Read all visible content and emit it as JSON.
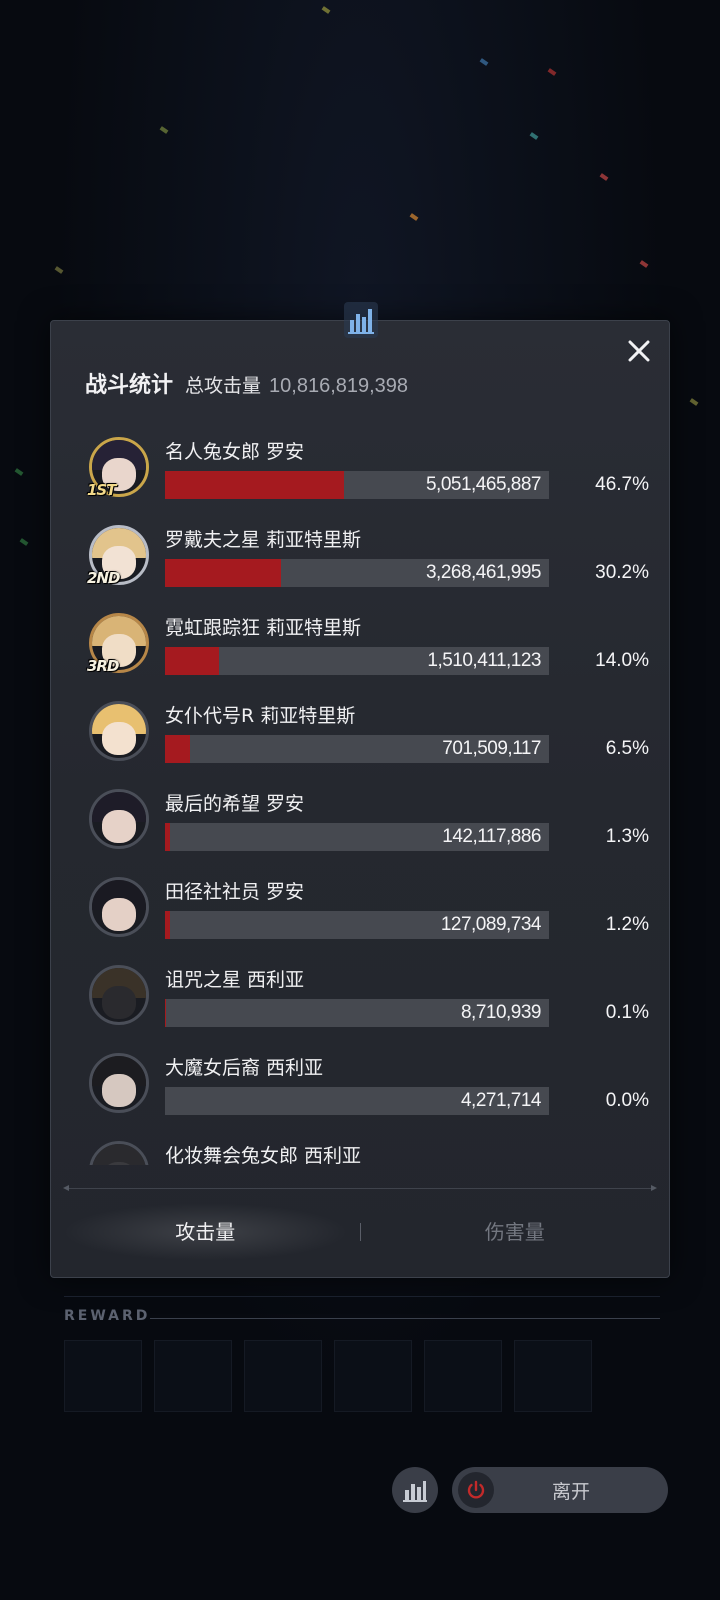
{
  "panel": {
    "title": "战斗统计",
    "total_label": "总攻击量",
    "total_value": "10,816,819,398"
  },
  "entries": [
    {
      "name": "名人兔女郎 罗安",
      "amount": "5,051,465,887",
      "percent": "46.7%",
      "share": 0.467,
      "rank": "1ST"
    },
    {
      "name": "罗戴夫之星 莉亚特里斯",
      "amount": "3,268,461,995",
      "percent": "30.2%",
      "share": 0.302,
      "rank": "2ND"
    },
    {
      "name": "霓虹跟踪狂 莉亚特里斯",
      "amount": "1,510,411,123",
      "percent": "14.0%",
      "share": 0.14,
      "rank": "3RD"
    },
    {
      "name": "女仆代号R 莉亚特里斯",
      "amount": "701,509,117",
      "percent": "6.5%",
      "share": 0.065
    },
    {
      "name": "最后的希望 罗安",
      "amount": "142,117,886",
      "percent": "1.3%",
      "share": 0.013
    },
    {
      "name": "田径社社员 罗安",
      "amount": "127,089,734",
      "percent": "1.2%",
      "share": 0.012
    },
    {
      "name": "诅咒之星 西利亚",
      "amount": "8,710,939",
      "percent": "0.1%",
      "share": 0.001
    },
    {
      "name": "大魔女后裔 西利亚",
      "amount": "4,271,714",
      "percent": "0.0%",
      "share": 0.0
    },
    {
      "name": "化妆舞会兔女郎 西利亚"
    }
  ],
  "tabs": {
    "attack": "攻击量",
    "damage": "伤害量"
  },
  "background": {
    "reward_label": "REWARD",
    "leave_label": "离开"
  },
  "icons": {
    "header": "bar-chart-icon",
    "close": "close-icon",
    "stats": "bar-chart-icon",
    "leave": "power-icon"
  },
  "colors": {
    "bar_fill": "#a51a1f",
    "bar_track": "#464950",
    "panel_bg": "#272a31"
  }
}
